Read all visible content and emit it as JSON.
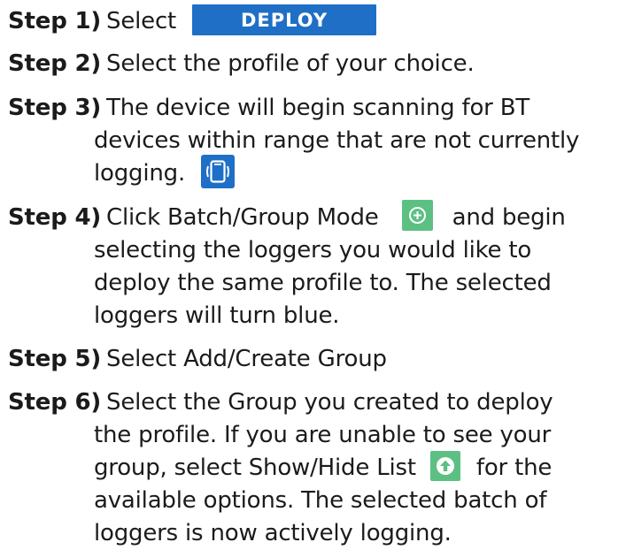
{
  "steps": [
    {
      "label": "Step 1)",
      "text": "Select",
      "button": "DEPLOY"
    },
    {
      "label": "Step 2)",
      "text": "Select the profile of your choice."
    },
    {
      "label": "Step 3)",
      "line1": "The device will begin scanning for BT",
      "line2": "devices within range that are not currently",
      "line3": "logging.",
      "icon": "bluetooth-device-scan-icon"
    },
    {
      "label": "Step 4)",
      "line1a": "Click Batch/Group Mode",
      "line1b": "and begin",
      "line2": "selecting the loggers you would like to",
      "line3": "deploy the same profile to. The selected",
      "line4": "loggers will turn blue.",
      "icon": "batch-group-mode-icon"
    },
    {
      "label": "Step 5)",
      "text": "Select Add/Create Group"
    },
    {
      "label": "Step 6)",
      "line1": "Select the Group you created to deploy",
      "line2": "the profile. If you are unable to see your",
      "line3a": "group, select Show/Hide List",
      "line3b": "for the",
      "line4": "available options. The selected batch of",
      "line5": "loggers is now actively logging.",
      "icon": "show-hide-list-icon"
    }
  ],
  "colors": {
    "deploy_button": "#1f6fc6",
    "scan_icon": "#1f6fc6",
    "green_icon": "#5cc083",
    "text": "#1b1b1b"
  }
}
